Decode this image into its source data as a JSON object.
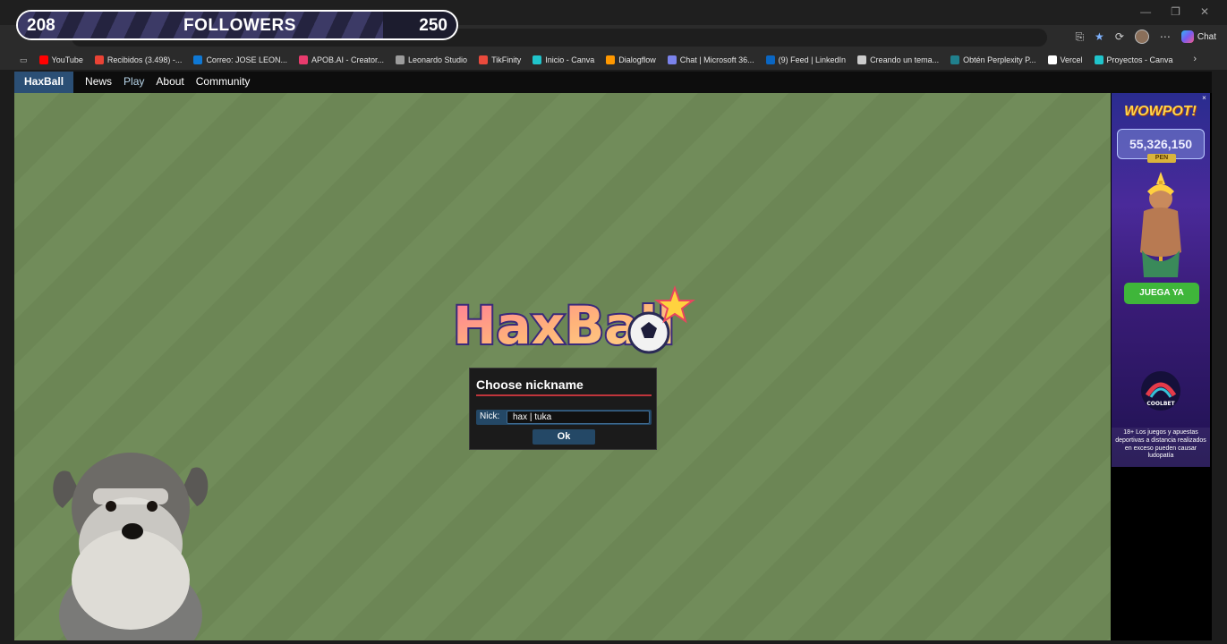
{
  "overlay": {
    "followers_current": "208",
    "followers_label": "FOLLOWERS",
    "followers_goal": "250",
    "progress_fraction": 0.832
  },
  "browser": {
    "chat_label": "Chat",
    "bookmarks": [
      {
        "label": "YouTube",
        "color": "#ff0000"
      },
      {
        "label": "Recibidos (3.498) -...",
        "color": "#ea4335"
      },
      {
        "label": "Correo: JOSE LEON...",
        "color": "#0f78d4"
      },
      {
        "label": "APOB.AI - Creator...",
        "color": "#e83b6d"
      },
      {
        "label": "Leonardo Studio",
        "color": "#9c9c9c"
      },
      {
        "label": "TikFinity",
        "color": "#e94a3c"
      },
      {
        "label": "Inicio - Canva",
        "color": "#20c4cb"
      },
      {
        "label": "Dialogflow",
        "color": "#ff9800"
      },
      {
        "label": "Chat | Microsoft 36...",
        "color": "#7b83eb"
      },
      {
        "label": "(9) Feed | LinkedIn",
        "color": "#0a66c2"
      },
      {
        "label": "Creando un tema...",
        "color": "#cccccc"
      },
      {
        "label": "Obtén Perplexity P...",
        "color": "#20808d"
      },
      {
        "label": "Vercel",
        "color": "#ffffff"
      },
      {
        "label": "Proyectos - Canva",
        "color": "#20c4cb"
      }
    ]
  },
  "site": {
    "brand": "HaxBall",
    "nav": [
      "News",
      "Play",
      "About",
      "Community"
    ],
    "active_nav": "Play"
  },
  "dialog": {
    "title": "Choose nickname",
    "nick_label": "Nick:",
    "nick_value": "hax | tuka",
    "ok_label": "Ok"
  },
  "ad": {
    "headline": "WOWPOT!",
    "jackpot": "55,326,150",
    "currency": "PEN",
    "cta": "JUEGA YA",
    "brand": "COOLBET",
    "disclaimer": "18+ Los juegos y apuestas deportivas a distancia realizados en exceso pueden causar ludopatía"
  },
  "colors": {
    "field_green": "#718c5a",
    "nav_brand_bg": "#2b4f75",
    "dialog_accent": "#c0353b",
    "ad_cta": "#3fb63a"
  }
}
